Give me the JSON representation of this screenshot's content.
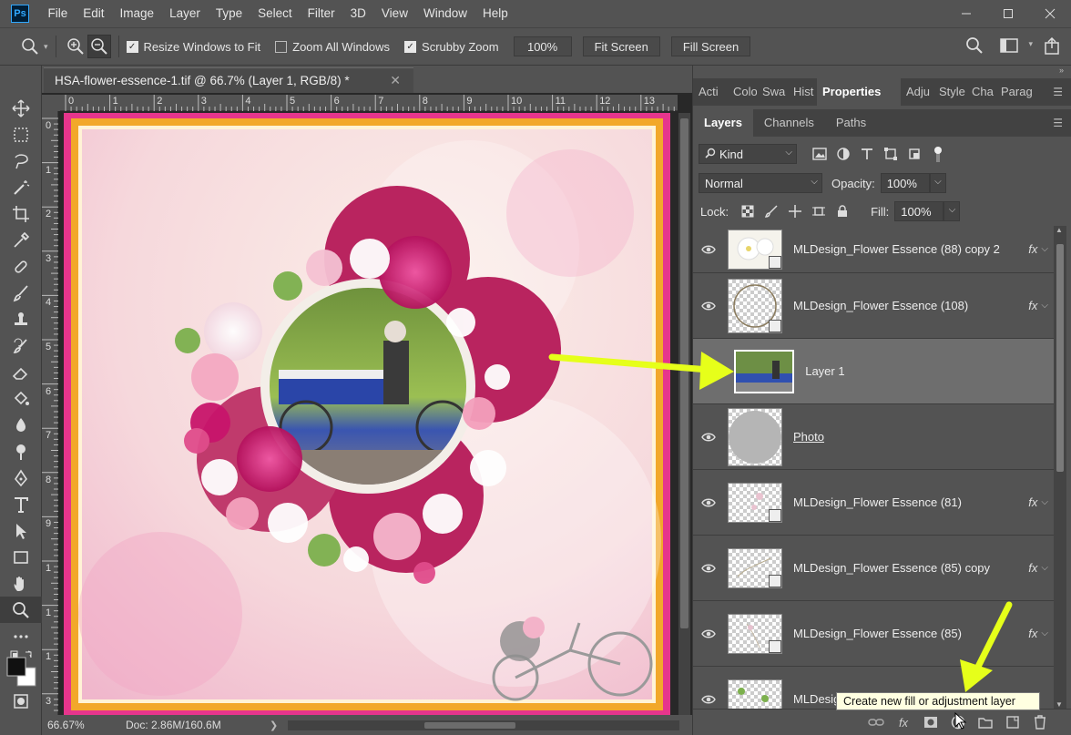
{
  "app": {
    "logo_text": "Ps",
    "menu": [
      "File",
      "Edit",
      "Image",
      "Layer",
      "Type",
      "Select",
      "Filter",
      "3D",
      "View",
      "Window",
      "Help"
    ]
  },
  "window_controls": [
    "minimize",
    "restore",
    "close"
  ],
  "options_bar": {
    "checks": [
      {
        "label": "Resize Windows to Fit",
        "checked": true
      },
      {
        "label": "Zoom All Windows",
        "checked": false
      },
      {
        "label": "Scrubby Zoom",
        "checked": true
      }
    ],
    "zoom_value": "100%",
    "fit_screen": "Fit Screen",
    "fill_screen": "Fill Screen"
  },
  "document": {
    "tab_title": "HSA-flower-essence-1.tif @ 66.7% (Layer 1, RGB/8) *",
    "close_glyph": "✕",
    "ruler_h": [
      "0",
      "1",
      "2",
      "3",
      "4",
      "5",
      "6",
      "7",
      "8",
      "9",
      "10",
      "11",
      "12",
      "13"
    ],
    "ruler_v": [
      "0",
      "1",
      "2",
      "3",
      "4",
      "5",
      "6",
      "7",
      "8",
      "9",
      "1",
      "1",
      "1",
      "3"
    ]
  },
  "status": {
    "zoom": "66.67%",
    "doc": "Doc: 2.86M/160.6M",
    "arrow": "❯"
  },
  "panels": {
    "top_tabs": [
      "Acti",
      "Colo",
      "Swa",
      "Hist",
      "Properties",
      "Adju",
      "Style",
      "Cha",
      "Parag"
    ],
    "top_active": "Properties",
    "layer_tabs": [
      "Layers",
      "Channels",
      "Paths"
    ],
    "layer_active": "Layers",
    "filter_kind": "Kind",
    "blend_mode": "Normal",
    "opacity_label": "Opacity:",
    "opacity_value": "100%",
    "lock_label": "Lock:",
    "fill_label": "Fill:",
    "fill_value": "100%"
  },
  "layers": [
    {
      "name": "MLDesign_Flower Essence (88) copy 2",
      "fx": true,
      "selected": false,
      "visible": true
    },
    {
      "name": "MLDesign_Flower Essence (108)",
      "fx": true,
      "selected": false,
      "visible": true
    },
    {
      "name": "Layer 1",
      "fx": false,
      "selected": true,
      "visible": false
    },
    {
      "name": "Photo",
      "fx": false,
      "selected": false,
      "visible": true
    },
    {
      "name": "MLDesign_Flower Essence (81)",
      "fx": true,
      "selected": false,
      "visible": true
    },
    {
      "name": "MLDesign_Flower Essence (85) copy",
      "fx": true,
      "selected": false,
      "visible": true
    },
    {
      "name": "MLDesign_Flower Essence (85)",
      "fx": true,
      "selected": false,
      "visible": true
    },
    {
      "name": "MLDesig",
      "fx": false,
      "selected": false,
      "visible": true
    }
  ],
  "fx_label": "fx",
  "tooltip": "Create new fill or adjustment layer",
  "colors": {
    "accent_arrow": "#e6ff1a",
    "canvas_border": "#e6358c",
    "orange_frame": "#f2a82a"
  }
}
